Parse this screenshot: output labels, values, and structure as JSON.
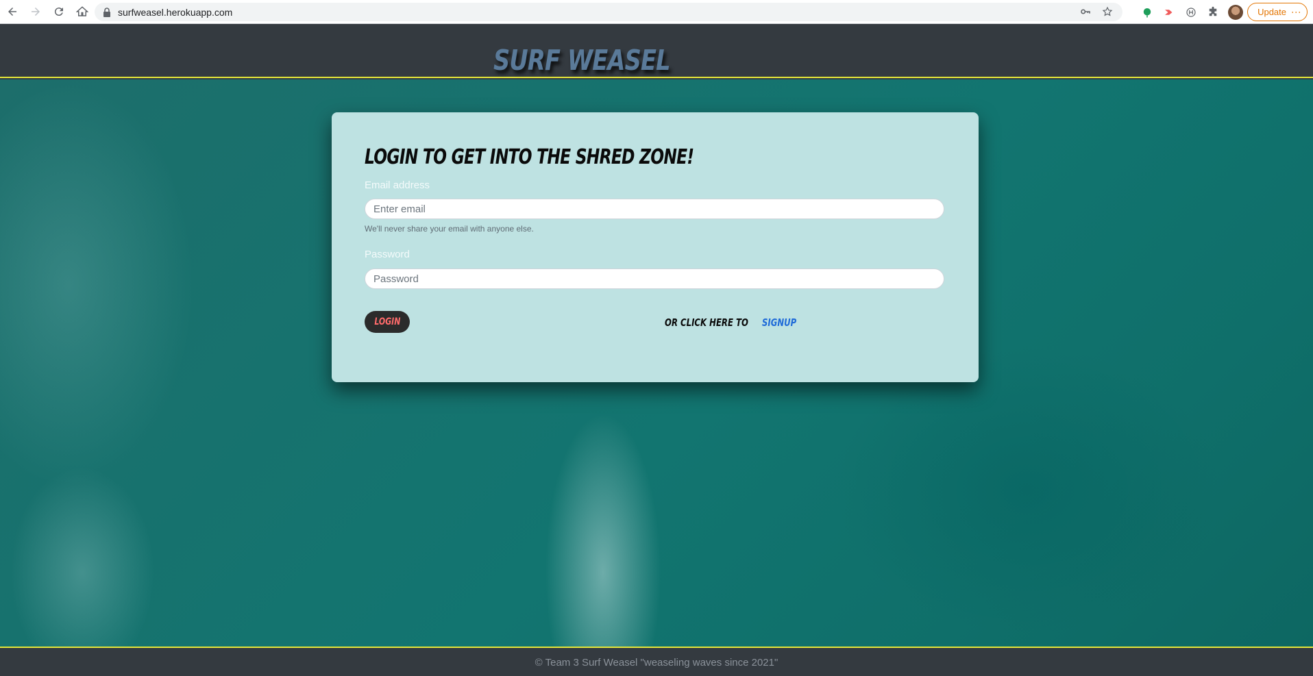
{
  "browser": {
    "url": "surfweasel.herokuapp.com",
    "update_label": "Update"
  },
  "header": {
    "brand": "SURF WEASEL"
  },
  "login_form": {
    "heading": "LOGIN TO GET INTO THE SHRED ZONE!",
    "email_label": "Email address",
    "email_placeholder": "Enter email",
    "email_value": "",
    "email_help": "We'll never share your email with anyone else.",
    "password_label": "Password",
    "password_placeholder": "Password",
    "password_value": "",
    "login_label": "LOGIN",
    "signup_prompt": "OR CLICK HERE TO",
    "signup_link": "SIGNUP"
  },
  "footer": {
    "text": "© Team 3 Surf Weasel \"weaseling waves since 2021\""
  },
  "colors": {
    "header_bg": "#343a40",
    "accent_line": "#e6e83a",
    "brand": "#5a7a99",
    "card_bg": "#cbebeb",
    "login_btn_bg": "#2b2b2b",
    "login_btn_text": "#ff6b6b",
    "signup_link": "#1e6ad8"
  }
}
